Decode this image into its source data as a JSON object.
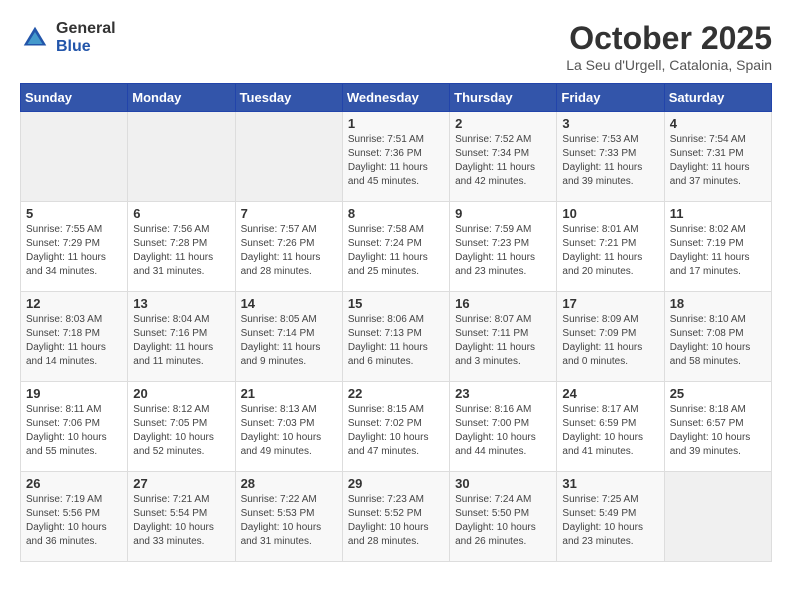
{
  "header": {
    "logo_general": "General",
    "logo_blue": "Blue",
    "month_title": "October 2025",
    "location": "La Seu d'Urgell, Catalonia, Spain"
  },
  "days_of_week": [
    "Sunday",
    "Monday",
    "Tuesday",
    "Wednesday",
    "Thursday",
    "Friday",
    "Saturday"
  ],
  "weeks": [
    [
      {
        "day": "",
        "info": ""
      },
      {
        "day": "",
        "info": ""
      },
      {
        "day": "",
        "info": ""
      },
      {
        "day": "1",
        "info": "Sunrise: 7:51 AM\nSunset: 7:36 PM\nDaylight: 11 hours\nand 45 minutes."
      },
      {
        "day": "2",
        "info": "Sunrise: 7:52 AM\nSunset: 7:34 PM\nDaylight: 11 hours\nand 42 minutes."
      },
      {
        "day": "3",
        "info": "Sunrise: 7:53 AM\nSunset: 7:33 PM\nDaylight: 11 hours\nand 39 minutes."
      },
      {
        "day": "4",
        "info": "Sunrise: 7:54 AM\nSunset: 7:31 PM\nDaylight: 11 hours\nand 37 minutes."
      }
    ],
    [
      {
        "day": "5",
        "info": "Sunrise: 7:55 AM\nSunset: 7:29 PM\nDaylight: 11 hours\nand 34 minutes."
      },
      {
        "day": "6",
        "info": "Sunrise: 7:56 AM\nSunset: 7:28 PM\nDaylight: 11 hours\nand 31 minutes."
      },
      {
        "day": "7",
        "info": "Sunrise: 7:57 AM\nSunset: 7:26 PM\nDaylight: 11 hours\nand 28 minutes."
      },
      {
        "day": "8",
        "info": "Sunrise: 7:58 AM\nSunset: 7:24 PM\nDaylight: 11 hours\nand 25 minutes."
      },
      {
        "day": "9",
        "info": "Sunrise: 7:59 AM\nSunset: 7:23 PM\nDaylight: 11 hours\nand 23 minutes."
      },
      {
        "day": "10",
        "info": "Sunrise: 8:01 AM\nSunset: 7:21 PM\nDaylight: 11 hours\nand 20 minutes."
      },
      {
        "day": "11",
        "info": "Sunrise: 8:02 AM\nSunset: 7:19 PM\nDaylight: 11 hours\nand 17 minutes."
      }
    ],
    [
      {
        "day": "12",
        "info": "Sunrise: 8:03 AM\nSunset: 7:18 PM\nDaylight: 11 hours\nand 14 minutes."
      },
      {
        "day": "13",
        "info": "Sunrise: 8:04 AM\nSunset: 7:16 PM\nDaylight: 11 hours\nand 11 minutes."
      },
      {
        "day": "14",
        "info": "Sunrise: 8:05 AM\nSunset: 7:14 PM\nDaylight: 11 hours\nand 9 minutes."
      },
      {
        "day": "15",
        "info": "Sunrise: 8:06 AM\nSunset: 7:13 PM\nDaylight: 11 hours\nand 6 minutes."
      },
      {
        "day": "16",
        "info": "Sunrise: 8:07 AM\nSunset: 7:11 PM\nDaylight: 11 hours\nand 3 minutes."
      },
      {
        "day": "17",
        "info": "Sunrise: 8:09 AM\nSunset: 7:09 PM\nDaylight: 11 hours\nand 0 minutes."
      },
      {
        "day": "18",
        "info": "Sunrise: 8:10 AM\nSunset: 7:08 PM\nDaylight: 10 hours\nand 58 minutes."
      }
    ],
    [
      {
        "day": "19",
        "info": "Sunrise: 8:11 AM\nSunset: 7:06 PM\nDaylight: 10 hours\nand 55 minutes."
      },
      {
        "day": "20",
        "info": "Sunrise: 8:12 AM\nSunset: 7:05 PM\nDaylight: 10 hours\nand 52 minutes."
      },
      {
        "day": "21",
        "info": "Sunrise: 8:13 AM\nSunset: 7:03 PM\nDaylight: 10 hours\nand 49 minutes."
      },
      {
        "day": "22",
        "info": "Sunrise: 8:15 AM\nSunset: 7:02 PM\nDaylight: 10 hours\nand 47 minutes."
      },
      {
        "day": "23",
        "info": "Sunrise: 8:16 AM\nSunset: 7:00 PM\nDaylight: 10 hours\nand 44 minutes."
      },
      {
        "day": "24",
        "info": "Sunrise: 8:17 AM\nSunset: 6:59 PM\nDaylight: 10 hours\nand 41 minutes."
      },
      {
        "day": "25",
        "info": "Sunrise: 8:18 AM\nSunset: 6:57 PM\nDaylight: 10 hours\nand 39 minutes."
      }
    ],
    [
      {
        "day": "26",
        "info": "Sunrise: 7:19 AM\nSunset: 5:56 PM\nDaylight: 10 hours\nand 36 minutes."
      },
      {
        "day": "27",
        "info": "Sunrise: 7:21 AM\nSunset: 5:54 PM\nDaylight: 10 hours\nand 33 minutes."
      },
      {
        "day": "28",
        "info": "Sunrise: 7:22 AM\nSunset: 5:53 PM\nDaylight: 10 hours\nand 31 minutes."
      },
      {
        "day": "29",
        "info": "Sunrise: 7:23 AM\nSunset: 5:52 PM\nDaylight: 10 hours\nand 28 minutes."
      },
      {
        "day": "30",
        "info": "Sunrise: 7:24 AM\nSunset: 5:50 PM\nDaylight: 10 hours\nand 26 minutes."
      },
      {
        "day": "31",
        "info": "Sunrise: 7:25 AM\nSunset: 5:49 PM\nDaylight: 10 hours\nand 23 minutes."
      },
      {
        "day": "",
        "info": ""
      }
    ]
  ]
}
